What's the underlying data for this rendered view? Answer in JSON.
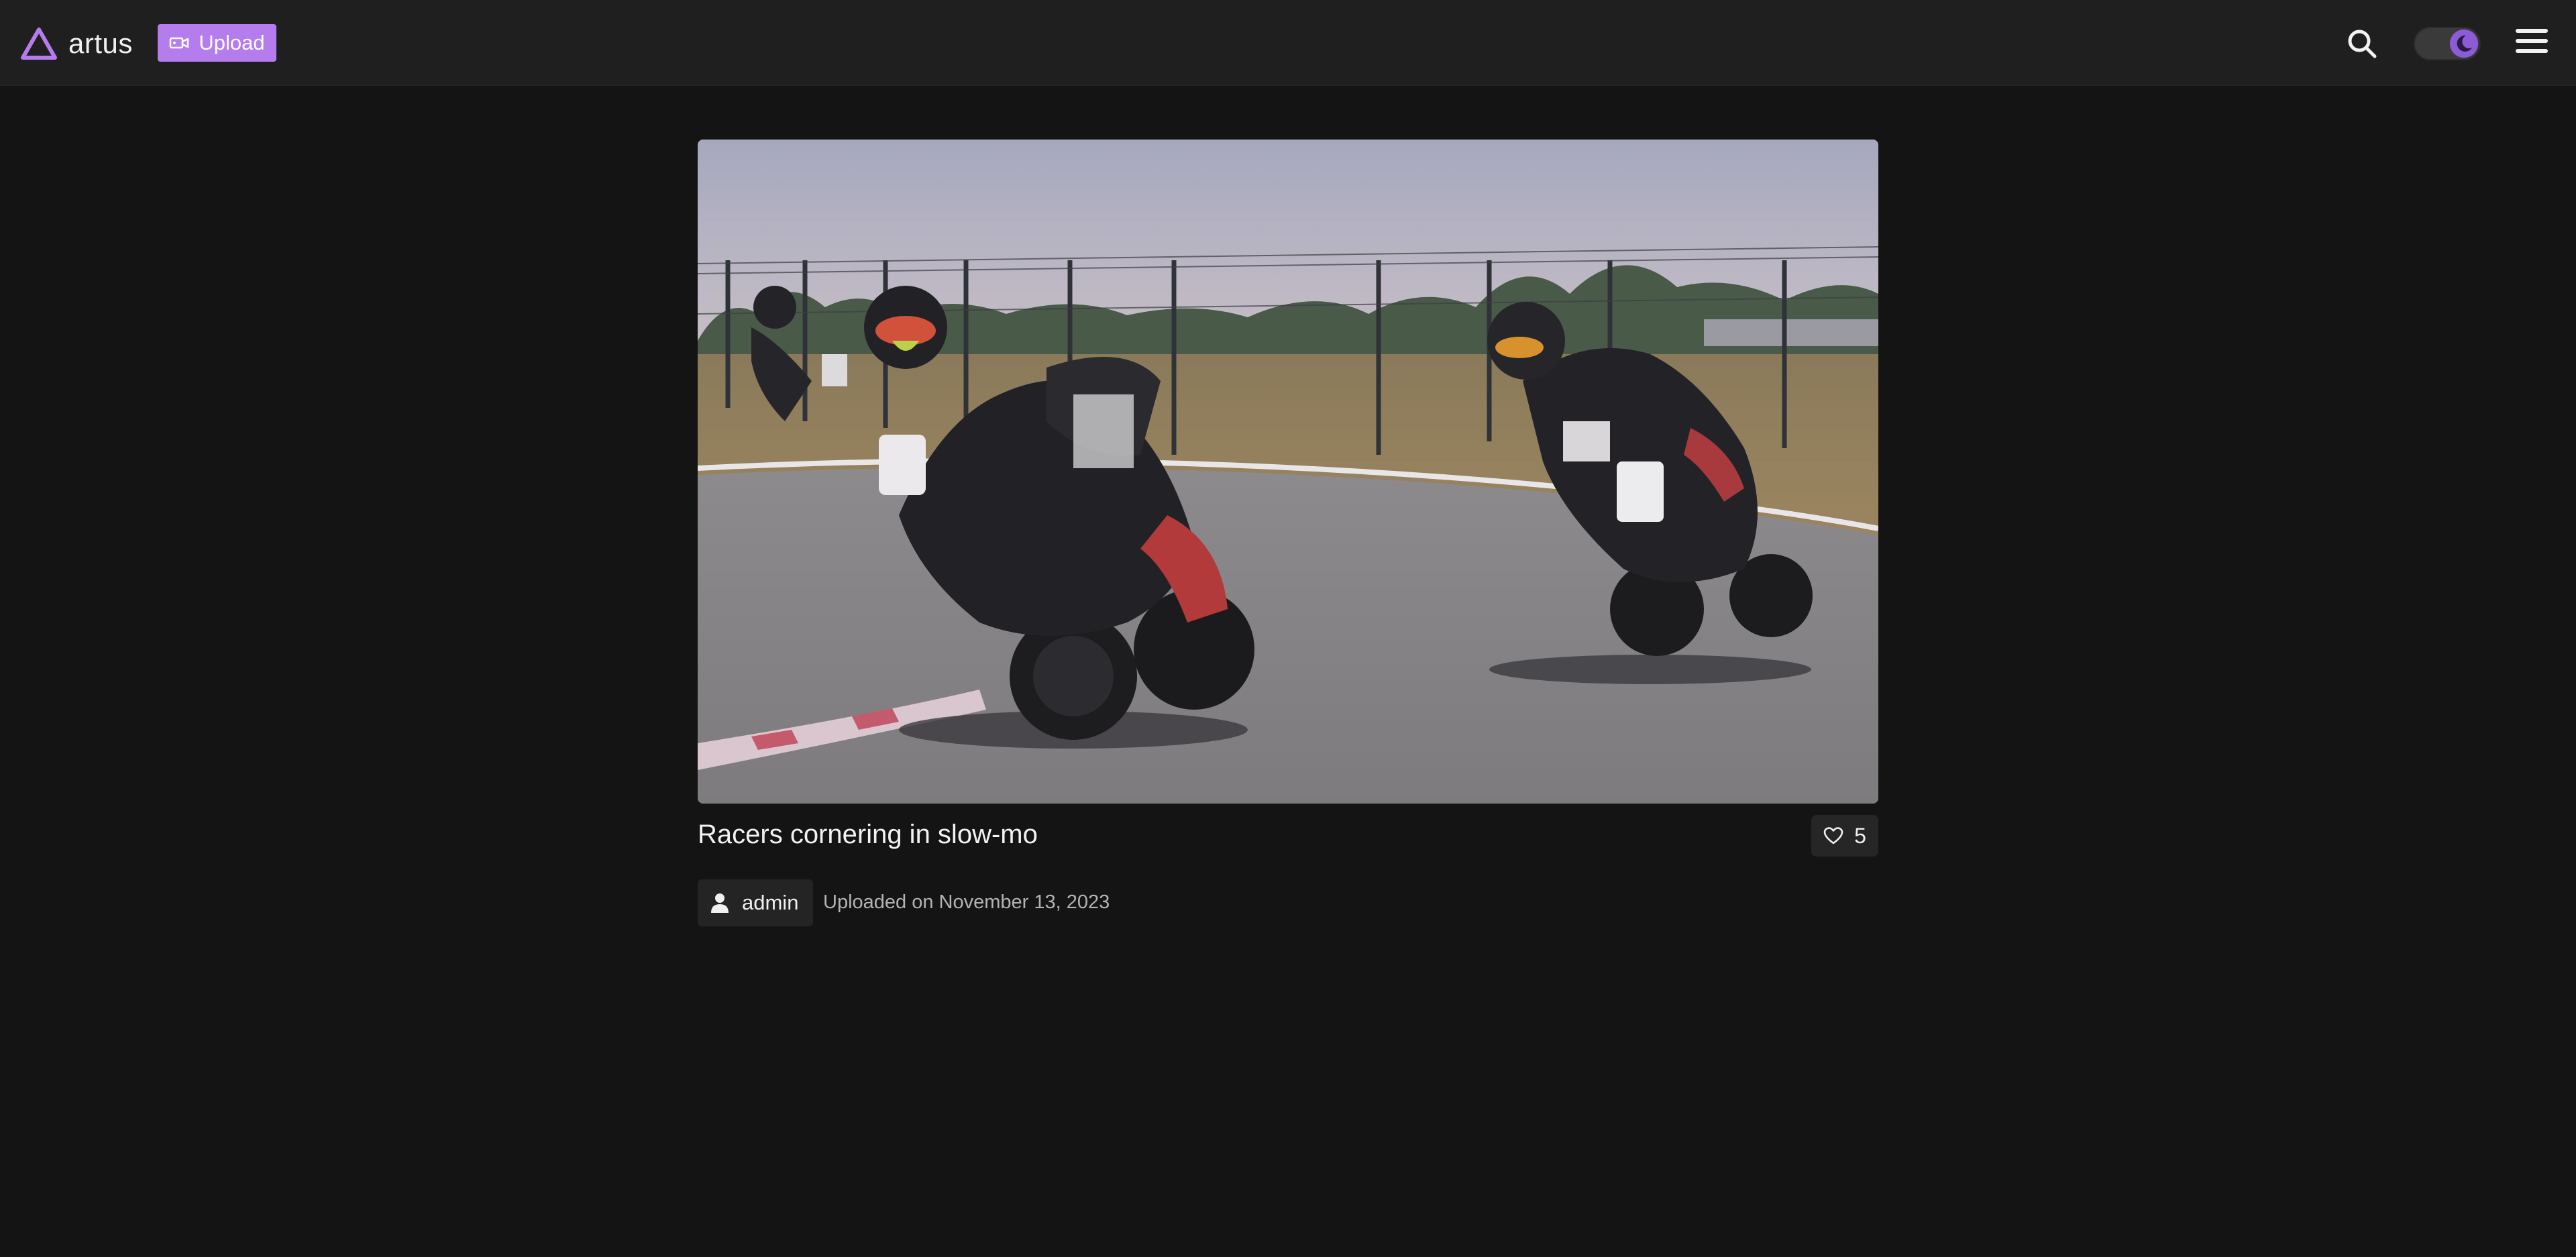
{
  "app": {
    "name": "artus",
    "accent_color": "#b57ced"
  },
  "header": {
    "logo_icon": "triangle-logo-icon",
    "upload_label": "Upload",
    "upload_icon": "video-camera-icon",
    "search_icon": "search-icon",
    "theme_toggle_icon": "moon-icon",
    "theme_mode": "dark",
    "menu_icon": "hamburger-menu-icon"
  },
  "video": {
    "thumbnail_alt": "motorcycle racers cornering on a track",
    "title": "Racers cornering in slow-mo",
    "likes": "5",
    "like_icon": "heart-icon",
    "author": "admin",
    "author_icon": "user-icon",
    "uploaded_text": "Uploaded on November 13, 2023"
  }
}
